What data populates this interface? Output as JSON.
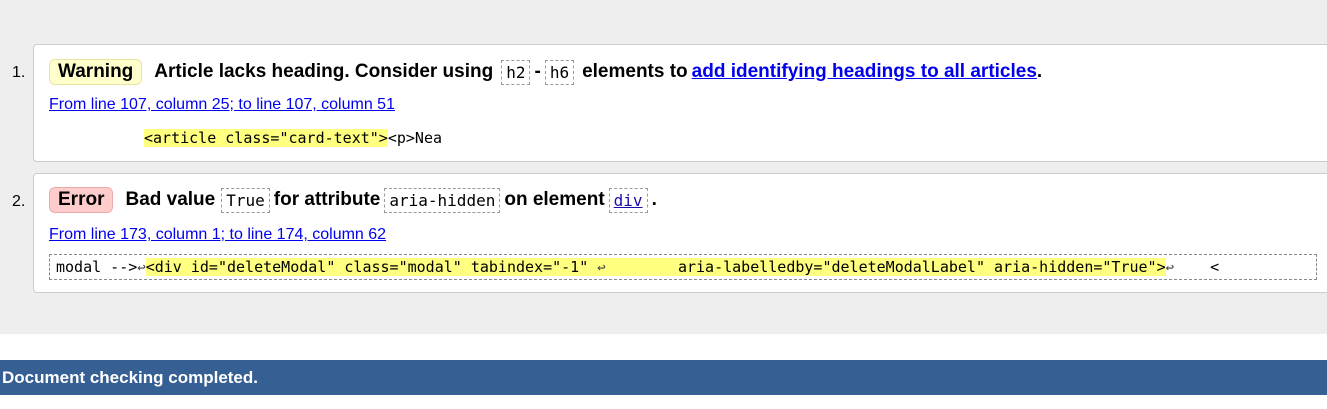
{
  "messages": [
    {
      "number": "1.",
      "type_label": "Warning",
      "text_before": "Article lacks heading. Consider using",
      "code_a": "h2",
      "dash": "-",
      "code_b": "h6",
      "text_middle": "elements to",
      "link_text": "add identifying headings to all articles",
      "text_end": ".",
      "location": "From line 107, column 25; to line 107, column 51",
      "extract_highlight": "<article class=\"card-text\">",
      "extract_after": "<p>Nea"
    },
    {
      "number": "2.",
      "type_label": "Error",
      "text_a": "Bad value",
      "code_value": "True",
      "text_b": "for attribute",
      "code_attr": "aria-hidden",
      "text_c": "on element",
      "code_elem": "div",
      "text_end": ".",
      "location": "From line 173, column 1; to line 174, column 62",
      "extract_before": "modal -->",
      "extract_highlight_1": "<div id=\"deleteModal\" class=\"modal\" tabindex=\"-1\" ",
      "extract_highlight_2": "        aria-labelledby=\"deleteModalLabel\" aria-hidden=\"True\">",
      "extract_after": "    <",
      "linefeed_glyph": "↩"
    }
  ],
  "footer": {
    "status": "Document checking completed."
  },
  "colors": {
    "warning_badge": "#ffffcc",
    "error_badge": "#ffcccc",
    "highlight": "#ffff80",
    "footer_bg": "#365f94"
  }
}
